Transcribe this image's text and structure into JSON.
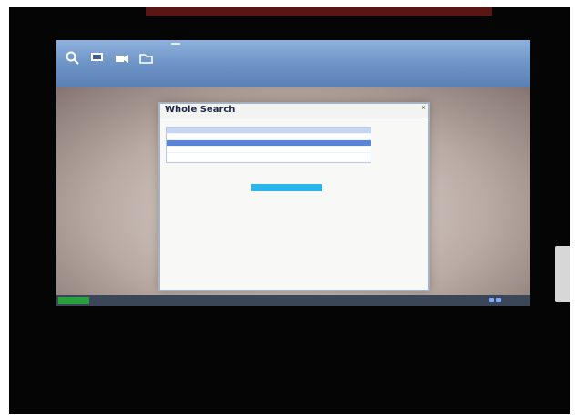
{
  "ribbon": {
    "tabs": [
      "",
      "",
      "",
      "",
      "",
      "",
      "",
      ""
    ],
    "active_tab_index": 5,
    "tools": [
      {
        "label": "",
        "icon": "magnifier-icon"
      },
      {
        "label": "",
        "icon": "screen-icon"
      },
      {
        "label": "",
        "icon": "camera-icon"
      },
      {
        "label": "",
        "icon": "folder-icon"
      }
    ]
  },
  "window": {
    "title": "Whole Search",
    "help_link": "",
    "subheading": "",
    "results_columns": [
      "",
      "",
      "",
      ""
    ],
    "results_rows": [
      {
        "cells": [
          "",
          "",
          "",
          ""
        ],
        "selected": false
      },
      {
        "cells": [
          "",
          "",
          "",
          ""
        ],
        "selected": true
      },
      {
        "cells": [
          "",
          "",
          "",
          ""
        ],
        "selected": false
      },
      {
        "cells": [
          "",
          "",
          "",
          ""
        ],
        "selected": false
      }
    ],
    "status_message": "",
    "list_options": [
      "",
      "",
      "",
      "",
      "",
      "",
      "",
      "",
      "",
      "",
      "",
      "",
      "",
      "",
      "",
      ""
    ],
    "selected_option_index": 0,
    "footer_message": ""
  },
  "taskbar": {
    "start_label": "",
    "task_item": "",
    "clock": ""
  },
  "colors": {
    "ribbon": "#6f95c8",
    "selection": "#29b5ee",
    "title_text": "#1e2b4c",
    "link_text": "#3a55c4",
    "taskbar": "#3b4658"
  }
}
